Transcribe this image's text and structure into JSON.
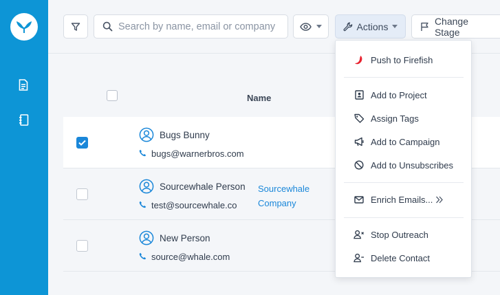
{
  "toolbar": {
    "search_placeholder": "Search by name, email or company",
    "actions_label": "Actions",
    "change_stage_label": "Change Stage"
  },
  "table": {
    "header_name": "Name",
    "rows": [
      {
        "name": "Bugs Bunny",
        "email": "bugs@warnerbros.com",
        "company_line1": "",
        "company_line2": "",
        "selected": true
      },
      {
        "name": "Sourcewhale Person",
        "email": "test@sourcewhale.co",
        "company_line1": "Sourcewhale",
        "company_line2": "Company",
        "selected": false
      },
      {
        "name": "New Person",
        "email": "source@whale.com",
        "company_line1": "",
        "company_line2": "",
        "selected": false
      }
    ]
  },
  "actions_menu": {
    "items": [
      {
        "label": "Push to Firefish",
        "icon": "firefish-icon"
      },
      {
        "label": "Add to Project",
        "icon": "project-icon"
      },
      {
        "label": "Assign Tags",
        "icon": "tag-icon"
      },
      {
        "label": "Add to Campaign",
        "icon": "megaphone-icon"
      },
      {
        "label": "Add to Unsubscribes",
        "icon": "block-icon"
      },
      {
        "label": "Enrich Emails...",
        "icon": "envelope-icon"
      },
      {
        "label": "Stop Outreach",
        "icon": "user-x-icon"
      },
      {
        "label": "Delete Contact",
        "icon": "user-minus-icon"
      }
    ]
  },
  "colors": {
    "sidebar": "#0d95d6",
    "accent": "#1a87d9",
    "firefish": "#e8212e"
  }
}
